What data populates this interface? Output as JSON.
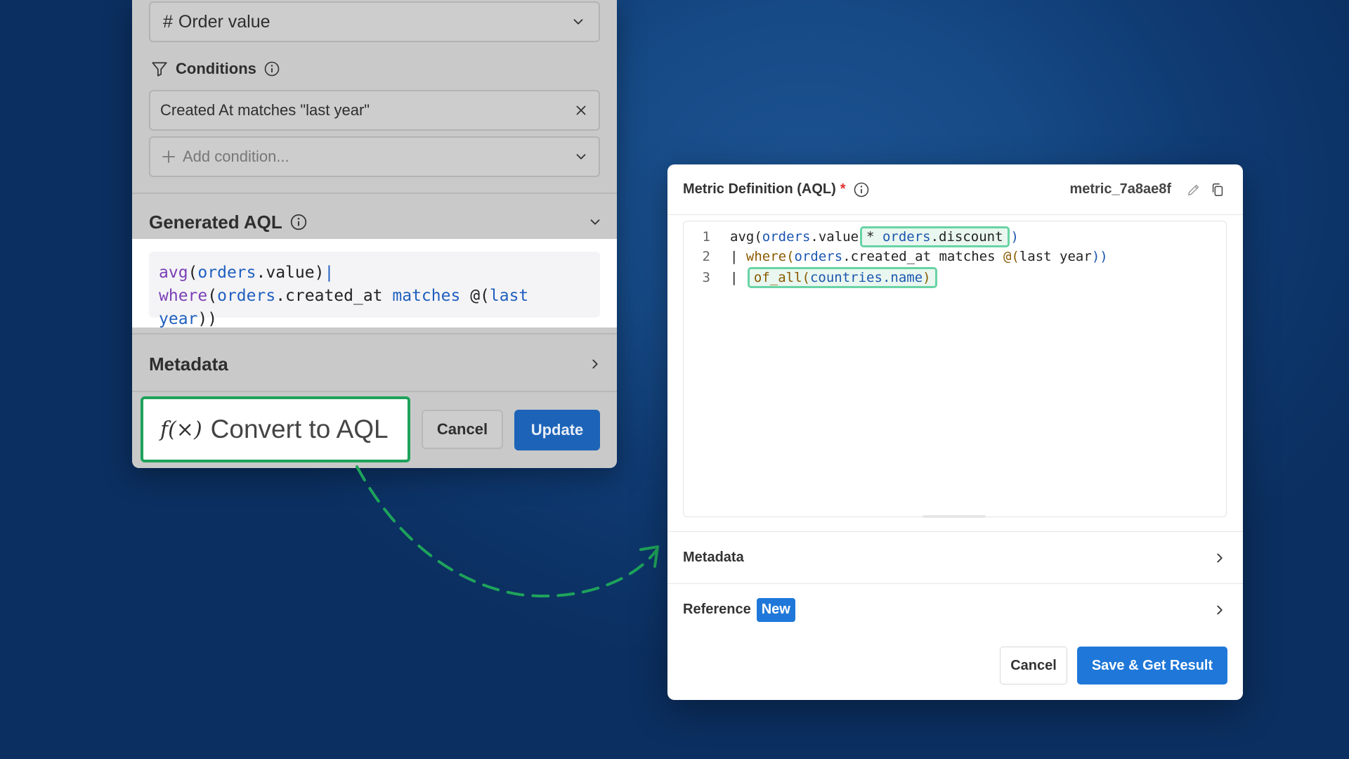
{
  "builder": {
    "measure": {
      "hash": "#",
      "label": "Order value"
    },
    "conditions": {
      "heading": "Conditions",
      "chip": "Created At matches \"last year\"",
      "add_placeholder": "Add condition..."
    },
    "generated": {
      "heading": "Generated AQL",
      "code_line1": {
        "fn": "avg",
        "open": "(",
        "model": "orders",
        "rest": ".value)",
        "pipe": "|"
      },
      "code_line2": {
        "fn": "where",
        "open": "(",
        "model": "orders",
        "field": ".created_at",
        "kw": "matches",
        "at": "@(",
        "arg1": "last",
        "arg2": "year",
        "close": "))"
      }
    },
    "metadata_label": "Metadata",
    "convert_button": {
      "fx": "f(×)",
      "label": "Convert to AQL"
    },
    "cancel_label": "Cancel",
    "update_label": "Update"
  },
  "definition": {
    "title": "Metric Definition (AQL)",
    "required_mark": "*",
    "metric_id": "metric_7a8ae8f",
    "lines": [
      {
        "num": "1",
        "t1": "avg(",
        "t2": "orders",
        "t3": ".value",
        "hl_op": "* ",
        "hl_model": "orders",
        "hl_field": ".discount",
        "t4": ")"
      },
      {
        "num": "2",
        "t1": "| ",
        "t2": "where",
        "t3": "(",
        "t4": "orders",
        "t5": ".created_at matches ",
        "t6": "@(",
        "t7": "last year",
        "t8": "))"
      },
      {
        "num": "3",
        "t1": "| ",
        "hl_fn": "of_all",
        "hl_open": "(",
        "hl_model": "countries",
        "hl_field": ".name",
        "hl_close": ")"
      }
    ],
    "metadata_label": "Metadata",
    "reference_label": "Reference",
    "reference_badge": "New",
    "cancel_label": "Cancel",
    "save_label": "Save & Get Result"
  },
  "colors": {
    "accent": "#1f78d9",
    "highlight": "#68d3a4",
    "arrow": "#1ea35b",
    "background": "#133f78"
  }
}
